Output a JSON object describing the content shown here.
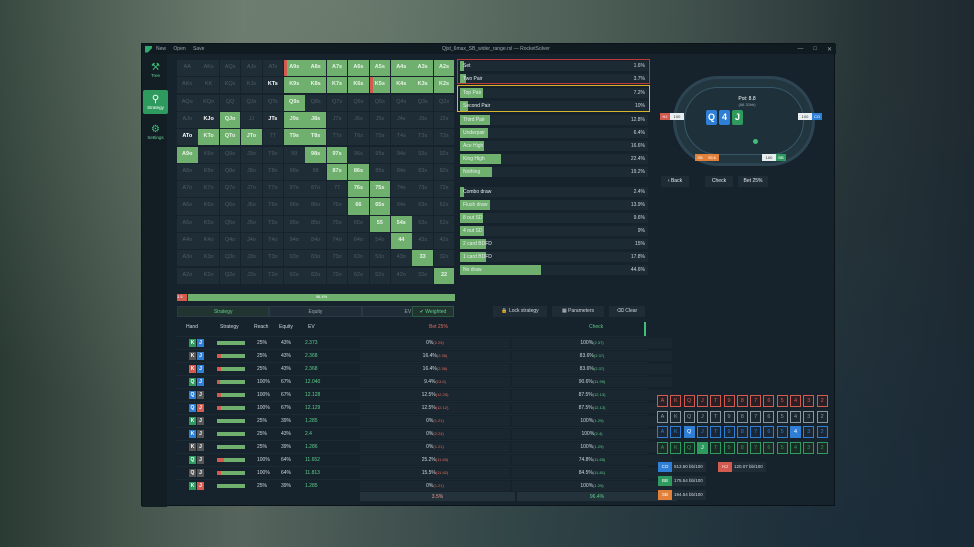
{
  "window": {
    "menu": [
      "New",
      "Open",
      "Save"
    ],
    "title": "Qjst_6max_SB_wider_range.rsl — RocketSolver",
    "controls": [
      "—",
      "□",
      "✕"
    ]
  },
  "sidebar": {
    "items": [
      {
        "label": "Tree",
        "icon": "hammer-icon"
      },
      {
        "label": "Strategy",
        "icon": "search-icon",
        "active": true
      },
      {
        "label": "Settings",
        "icon": "gear-icon"
      }
    ]
  },
  "colors": {
    "green": "#6fb06e",
    "red": "#d25a4f",
    "accent": "#3fbf7a"
  },
  "grid": {
    "ranks": [
      "A",
      "K",
      "Q",
      "J",
      "T",
      "9",
      "8",
      "7",
      "6",
      "5",
      "4",
      "3",
      "2"
    ],
    "cells": [
      [
        "AA",
        "AKs",
        "AQs",
        "AJs",
        "ATs",
        "A9s",
        "A8s",
        "A7s",
        "A6s",
        "A5s",
        "A4s",
        "A3s",
        "A2s"
      ],
      [
        "AKo",
        "KK",
        "KQs",
        "KJs",
        "KTs",
        "K9s",
        "K8s",
        "K7s",
        "K6s",
        "K5s",
        "K4s",
        "K3s",
        "K2s"
      ],
      [
        "AQo",
        "KQo",
        "QQ",
        "QJs",
        "QTs",
        "Q9s",
        "Q8s",
        "Q7s",
        "Q6s",
        "Q5s",
        "Q4s",
        "Q3s",
        "Q2s"
      ],
      [
        "AJo",
        "KJo",
        "QJo",
        "JJ",
        "JTs",
        "J9s",
        "J8s",
        "J7s",
        "J6s",
        "J5s",
        "J4s",
        "J3s",
        "J2s"
      ],
      [
        "ATo",
        "KTo",
        "QTo",
        "JTo",
        "TT",
        "T9s",
        "T8s",
        "T7s",
        "T6s",
        "T5s",
        "T4s",
        "T3s",
        "T2s"
      ],
      [
        "A9o",
        "K9o",
        "Q9o",
        "J9o",
        "T9o",
        "99",
        "98s",
        "97s",
        "96s",
        "95s",
        "94s",
        "93s",
        "92s"
      ],
      [
        "A8o",
        "K8o",
        "Q8o",
        "J8o",
        "T8o",
        "98o",
        "88",
        "87s",
        "86s",
        "85s",
        "84s",
        "83s",
        "82s"
      ],
      [
        "A7o",
        "K7o",
        "Q7o",
        "J7o",
        "T7o",
        "97o",
        "87o",
        "77",
        "76s",
        "75s",
        "74s",
        "73s",
        "72s"
      ],
      [
        "A6o",
        "K6o",
        "Q6o",
        "J6o",
        "T6o",
        "96o",
        "86o",
        "76o",
        "66",
        "65s",
        "64s",
        "63s",
        "62s"
      ],
      [
        "A5o",
        "K5o",
        "Q5o",
        "J5o",
        "T5o",
        "95o",
        "85o",
        "75o",
        "65o",
        "55",
        "54s",
        "53s",
        "52s"
      ],
      [
        "A4o",
        "K4o",
        "Q4o",
        "J4o",
        "T4o",
        "94o",
        "84o",
        "74o",
        "64o",
        "54o",
        "44",
        "43s",
        "42s"
      ],
      [
        "A3o",
        "K3o",
        "Q3o",
        "J3o",
        "T3o",
        "93o",
        "83o",
        "73o",
        "63o",
        "53o",
        "43o",
        "33",
        "32s"
      ],
      [
        "A2o",
        "K2o",
        "Q2o",
        "J2o",
        "T2o",
        "92o",
        "82o",
        "72o",
        "62o",
        "52o",
        "42o",
        "32o",
        "22"
      ]
    ],
    "filled": [
      [
        0,
        0,
        0,
        0,
        0,
        1,
        1,
        1,
        1,
        1,
        1,
        1,
        1
      ],
      [
        0,
        0,
        0,
        0,
        0,
        1,
        1,
        1,
        1,
        1,
        1,
        1,
        1
      ],
      [
        0,
        0,
        0,
        0,
        0,
        1,
        0,
        0,
        0,
        0,
        0,
        0,
        0
      ],
      [
        0,
        0,
        1,
        0,
        0,
        1,
        1,
        0,
        0,
        0,
        0,
        0,
        0
      ],
      [
        0,
        1,
        1,
        1,
        0,
        1,
        1,
        0,
        0,
        0,
        0,
        0,
        0
      ],
      [
        1,
        0,
        0,
        0,
        0,
        0,
        1,
        1,
        0,
        0,
        0,
        0,
        0
      ],
      [
        0,
        0,
        0,
        0,
        0,
        0,
        0,
        1,
        1,
        0,
        0,
        0,
        0
      ],
      [
        0,
        0,
        0,
        0,
        0,
        0,
        0,
        0,
        1,
        1,
        0,
        0,
        0
      ],
      [
        0,
        0,
        0,
        0,
        0,
        0,
        0,
        0,
        1,
        1,
        0,
        0,
        0
      ],
      [
        0,
        0,
        0,
        0,
        0,
        0,
        0,
        0,
        0,
        1,
        1,
        0,
        0
      ],
      [
        0,
        0,
        0,
        0,
        0,
        0,
        0,
        0,
        0,
        0,
        1,
        0,
        0
      ],
      [
        0,
        0,
        0,
        0,
        0,
        0,
        0,
        0,
        0,
        0,
        0,
        1,
        0
      ],
      [
        0,
        0,
        0,
        0,
        0,
        0,
        0,
        0,
        0,
        0,
        0,
        0,
        1
      ]
    ],
    "totals": {
      "bet": "3.5",
      "check": "96.4%"
    }
  },
  "categories": [
    {
      "label": "Set",
      "pct": "1.6%",
      "fill": 0.02,
      "box": "red"
    },
    {
      "label": "Two Pair",
      "pct": "3.7%",
      "fill": 0.03,
      "box": "red"
    },
    {
      "label": "Top Pair",
      "pct": "7.2%",
      "fill": 0.12,
      "box": "yellow"
    },
    {
      "label": "Second Pair",
      "pct": "10%",
      "fill": 0.04,
      "box": "yellow"
    },
    {
      "label": "Third Pair",
      "pct": "12.8%",
      "fill": 0.16
    },
    {
      "label": "Underpair",
      "pct": "6.4%",
      "fill": 0.15
    },
    {
      "label": "Ace High",
      "pct": "16.6%",
      "fill": 0.13
    },
    {
      "label": "King High",
      "pct": "22.4%",
      "fill": 0.22
    },
    {
      "label": "Nothing",
      "pct": "19.2%",
      "fill": 0.17
    },
    {
      "label": "Combo draw",
      "pct": "2.4%",
      "fill": 0.02
    },
    {
      "label": "Flush draw",
      "pct": "13.9%",
      "fill": 0.16
    },
    {
      "label": "8 out SD",
      "pct": "9.6%",
      "fill": 0.12
    },
    {
      "label": "4 out SD",
      "pct": "9%",
      "fill": 0.13
    },
    {
      "label": "2 card BDFD",
      "pct": "15%",
      "fill": 0.14
    },
    {
      "label": "1 card BDFD",
      "pct": "17.8%",
      "fill": 0.14
    },
    {
      "label": "No draw",
      "pct": "44.6%",
      "fill": 0.43
    }
  ],
  "tabs": [
    "Strategy",
    "Equity",
    "EV"
  ],
  "weighted": "Weighted",
  "tools": [
    "Lock strategy",
    "Parameters",
    "Clear"
  ],
  "table": {
    "headers": [
      "Hand",
      "Strategy",
      "Reach",
      "Equity",
      "EV",
      "Bet 25%",
      "Check"
    ],
    "rows": [
      {
        "c1": "K",
        "c1c": "#2e9a5e",
        "c2": "J",
        "c2c": "#2f7fd6",
        "reach": "25%",
        "equity": "43%",
        "ev": "2.373",
        "bet": "0%",
        "betev": "(2.25)",
        "chk": "100%",
        "chkev": "(2.37)",
        "betfrac": 0
      },
      {
        "c1": "K",
        "c1c": "#555",
        "c2": "J",
        "c2c": "#2f7fd6",
        "reach": "25%",
        "equity": "43%",
        "ev": "2.368",
        "bet": "16.4%",
        "betev": "(2.36)",
        "chk": "83.6%",
        "chkev": "(2.37)",
        "betfrac": 0.16
      },
      {
        "c1": "K",
        "c1c": "#d25a4f",
        "c2": "J",
        "c2c": "#2f7fd6",
        "reach": "25%",
        "equity": "43%",
        "ev": "2.368",
        "bet": "16.4%",
        "betev": "(2.36)",
        "chk": "83.6%",
        "chkev": "(2.37)",
        "betfrac": 0.16
      },
      {
        "c1": "Q",
        "c1c": "#2e9a5e",
        "c2": "J",
        "c2c": "#2f7fd6",
        "reach": "100%",
        "equity": "67%",
        "ev": "12.040",
        "bet": "9.4%",
        "betev": "(13.6)",
        "chk": "90.6%",
        "chkev": "(11.99)",
        "betfrac": 0.09
      },
      {
        "c1": "Q",
        "c1c": "#2f7fd6",
        "c2": "J",
        "c2c": "#555",
        "reach": "100%",
        "equity": "67%",
        "ev": "12.128",
        "bet": "12.5%",
        "betev": "(12.25)",
        "chk": "87.5%",
        "chkev": "(12.13)",
        "betfrac": 0.13
      },
      {
        "c1": "Q",
        "c1c": "#2f7fd6",
        "c2": "J",
        "c2c": "#d25a4f",
        "reach": "100%",
        "equity": "67%",
        "ev": "12.129",
        "bet": "12.5%",
        "betev": "(12.12)",
        "chk": "87.5%",
        "chkev": "(12.13)",
        "betfrac": 0.13
      },
      {
        "c1": "K",
        "c1c": "#2e9a5e",
        "c2": "J",
        "c2c": "#555",
        "reach": "25%",
        "equity": "39%",
        "ev": "1.285",
        "bet": "0%",
        "betev": "(1.21)",
        "chk": "100%",
        "chkev": "(1.29)",
        "betfrac": 0
      },
      {
        "c1": "K",
        "c1c": "#2f7fd6",
        "c2": "J",
        "c2c": "#555",
        "reach": "25%",
        "equity": "43%",
        "ev": "2.4",
        "bet": "0%",
        "betev": "(2.24)",
        "chk": "100%",
        "chkev": "(2.4)",
        "betfrac": 0
      },
      {
        "c1": "K",
        "c1c": "#555",
        "c2": "J",
        "c2c": "#555",
        "reach": "25%",
        "equity": "39%",
        "ev": "1.286",
        "bet": "0%",
        "betev": "(1.21)",
        "chk": "100%",
        "chkev": "(1.29)",
        "betfrac": 0
      },
      {
        "c1": "Q",
        "c1c": "#2e9a5e",
        "c2": "J",
        "c2c": "#555",
        "reach": "100%",
        "equity": "64%",
        "ev": "11.652",
        "bet": "25.2%",
        "betev": "(11.65)",
        "chk": "74.8%",
        "chkev": "(11.65)",
        "betfrac": 0.25
      },
      {
        "c1": "Q",
        "c1c": "#555",
        "c2": "J",
        "c2c": "#555",
        "reach": "100%",
        "equity": "64%",
        "ev": "11.813",
        "bet": "15.5%",
        "betev": "(11.82)",
        "chk": "84.5%",
        "chkev": "(11.81)",
        "betfrac": 0.16
      },
      {
        "c1": "K",
        "c1c": "#2e9a5e",
        "c2": "J",
        "c2c": "#d25a4f",
        "reach": "25%",
        "equity": "39%",
        "ev": "1.285",
        "bet": "0%",
        "betev": "(1.21)",
        "chk": "100%",
        "chkev": "(1.29)",
        "betfrac": 0
      }
    ],
    "footer": {
      "bet": "3.5%",
      "check": "96.4%"
    }
  },
  "pokertable": {
    "pot_label": "Pot: 8.8",
    "pot_sub": "(88.32bb)",
    "board": [
      {
        "r": "Q",
        "c": "#2f7fd6"
      },
      {
        "r": "4",
        "c": "#2f7fd6"
      },
      {
        "r": "J",
        "c": "#2e9a5e"
      }
    ],
    "seats": [
      {
        "pos": "HJ",
        "stack": "100",
        "pc": "#d25a4f"
      },
      {
        "pos": "CO",
        "stack": "100",
        "pc": "#2f7fd6"
      },
      {
        "pos": "SB",
        "stack": "95.6",
        "pc": "#e3813a"
      },
      {
        "pos": "BB",
        "stack": "100",
        "pc": "#2e9a5e"
      }
    ],
    "buttons": [
      "Back",
      "Check",
      "Bet 25%"
    ]
  },
  "cardmatrix": {
    "ranks": [
      "A",
      "K",
      "Q",
      "J",
      "T",
      "9",
      "8",
      "7",
      "6",
      "5",
      "4",
      "3",
      "2"
    ]
  },
  "stacks": [
    {
      "pos": "CO",
      "value": "513.60 bb/100",
      "pc": "#2f7fd6"
    },
    {
      "pos": "HJ",
      "value": "120.07 bb/100",
      "pc": "#d25a4f"
    },
    {
      "pos": "BB",
      "value": "175.54 bb/100",
      "pc": "#2e9a5e"
    },
    {
      "pos": "SB",
      "value": "194.54 bb/100",
      "pc": "#e3813a"
    }
  ]
}
